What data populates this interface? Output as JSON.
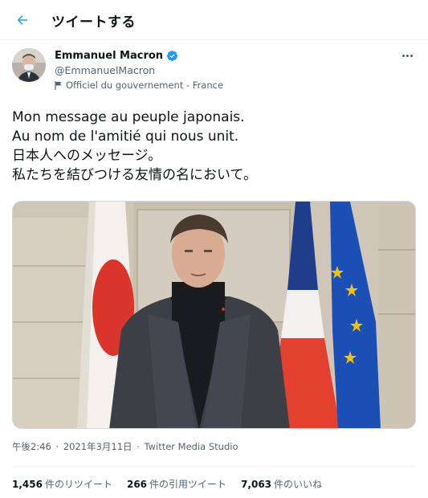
{
  "header": {
    "title": "ツイートする",
    "back_icon": "arrow-left-icon",
    "accent_color": "#1d9bf0"
  },
  "author": {
    "name": "Emmanuel Macron",
    "handle": "@EmmanuelMacron",
    "verified": true,
    "verified_icon": "verified-badge-icon",
    "label": "Officiel du gouvernement - France",
    "label_icon": "flag-icon"
  },
  "tweet": {
    "lines": [
      "Mon message au peuple japonais.",
      "Au nom de l'amitié qui nous unit.",
      "日本人へのメッセージ。",
      "私たちを結びつける友情の名において。"
    ]
  },
  "media": {
    "type": "video",
    "description_icons": [
      "japan-flag",
      "france-flag",
      "eu-flag"
    ]
  },
  "meta": {
    "time": "午後2:46",
    "date": "2021年3月11日",
    "separator": "·",
    "source": "Twitter Media Studio"
  },
  "stats": {
    "retweets_count": "1,456",
    "retweets_label": "件のリツイート",
    "quotes_count": "266",
    "quotes_label": "件の引用ツイート",
    "likes_count": "7,063",
    "likes_label": "件のいいね"
  }
}
